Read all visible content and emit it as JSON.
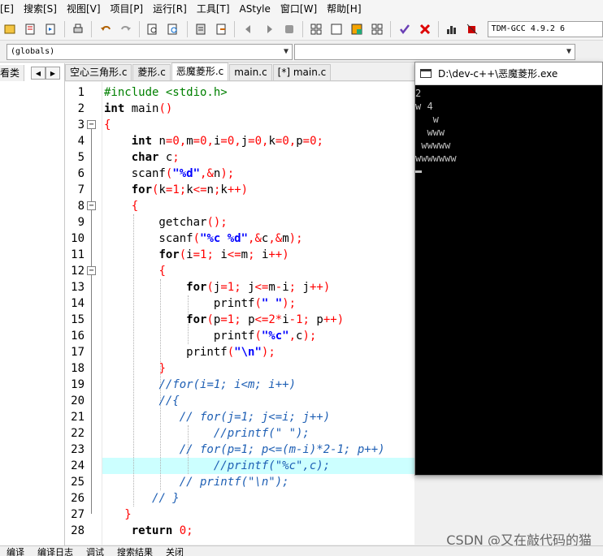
{
  "menu": [
    "[E]",
    "搜索[S]",
    "视图[V]",
    "项目[P]",
    "运行[R]",
    "工具[T]",
    "AStyle",
    "窗口[W]",
    "帮助[H]"
  ],
  "toolbar": {
    "compiler": "TDM-GCC 4.9.2 6",
    "icons": [
      "insert-icon",
      "toggle-bookmark-icon",
      "goto-bookmark-icon",
      "print-icon",
      "undo-icon",
      "redo-icon",
      "find-icon",
      "replace-icon",
      "new-class-icon",
      "toggle-icon",
      "back-icon",
      "forward-icon",
      "comment-icon",
      "compile-icon",
      "run-icon",
      "compile-run-icon",
      "rebuild-icon",
      "check-icon",
      "stop-icon",
      "chart-icon",
      "debug-icon"
    ]
  },
  "globals": {
    "value": "(globals)"
  },
  "left_panel": {
    "tab_label": "看类"
  },
  "tabs": [
    {
      "label": "空心三角形.c",
      "active": false
    },
    {
      "label": "菱形.c",
      "active": false
    },
    {
      "label": "恶魔菱形.c",
      "active": true
    },
    {
      "label": "main.c",
      "active": false
    },
    {
      "label": "[*] main.c",
      "active": false
    }
  ],
  "line_numbers": [
    "1",
    "2",
    "3",
    "4",
    "5",
    "6",
    "7",
    "8",
    "9",
    "10",
    "11",
    "12",
    "13",
    "14",
    "15",
    "16",
    "17",
    "18",
    "19",
    "20",
    "21",
    "22",
    "23",
    "24",
    "25",
    "26",
    "27",
    "28"
  ],
  "code": [
    [
      [
        "pp",
        "#include <stdio.h>"
      ]
    ],
    [
      [
        "kw",
        "int"
      ],
      [
        "plain",
        " main"
      ],
      [
        "bracket",
        "()"
      ]
    ],
    [
      [
        "bracket",
        "{"
      ]
    ],
    [
      [
        "plain",
        "    "
      ],
      [
        "kw",
        "int"
      ],
      [
        "plain",
        " n"
      ],
      [
        "op",
        "="
      ],
      [
        "num",
        "0"
      ],
      [
        "op",
        ","
      ],
      [
        "plain",
        "m"
      ],
      [
        "op",
        "="
      ],
      [
        "num",
        "0"
      ],
      [
        "op",
        ","
      ],
      [
        "plain",
        "i"
      ],
      [
        "op",
        "="
      ],
      [
        "num",
        "0"
      ],
      [
        "op",
        ","
      ],
      [
        "plain",
        "j"
      ],
      [
        "op",
        "="
      ],
      [
        "num",
        "0"
      ],
      [
        "op",
        ","
      ],
      [
        "plain",
        "k"
      ],
      [
        "op",
        "="
      ],
      [
        "num",
        "0"
      ],
      [
        "op",
        ","
      ],
      [
        "plain",
        "p"
      ],
      [
        "op",
        "="
      ],
      [
        "num",
        "0"
      ],
      [
        "op",
        ";"
      ]
    ],
    [
      [
        "plain",
        "    "
      ],
      [
        "kw",
        "char"
      ],
      [
        "plain",
        " c"
      ],
      [
        "op",
        ";"
      ]
    ],
    [
      [
        "plain",
        "    scanf"
      ],
      [
        "bracket",
        "("
      ],
      [
        "str",
        "\"%d\""
      ],
      [
        "op",
        ",&"
      ],
      [
        "plain",
        "n"
      ],
      [
        "bracket",
        ")"
      ],
      [
        "op",
        ";"
      ]
    ],
    [
      [
        "plain",
        "    "
      ],
      [
        "kw",
        "for"
      ],
      [
        "bracket",
        "("
      ],
      [
        "plain",
        "k"
      ],
      [
        "op",
        "="
      ],
      [
        "num",
        "1"
      ],
      [
        "op",
        ";"
      ],
      [
        "plain",
        "k"
      ],
      [
        "op",
        "<="
      ],
      [
        "plain",
        "n"
      ],
      [
        "op",
        ";"
      ],
      [
        "plain",
        "k"
      ],
      [
        "op",
        "++"
      ],
      [
        "bracket",
        ")"
      ]
    ],
    [
      [
        "plain",
        "    "
      ],
      [
        "bracket",
        "{"
      ]
    ],
    [
      [
        "plain",
        "        getchar"
      ],
      [
        "bracket",
        "()"
      ],
      [
        "op",
        ";"
      ]
    ],
    [
      [
        "plain",
        "        scanf"
      ],
      [
        "bracket",
        "("
      ],
      [
        "str",
        "\"%c %d\""
      ],
      [
        "op",
        ",&"
      ],
      [
        "plain",
        "c"
      ],
      [
        "op",
        ",&"
      ],
      [
        "plain",
        "m"
      ],
      [
        "bracket",
        ")"
      ],
      [
        "op",
        ";"
      ]
    ],
    [
      [
        "plain",
        "        "
      ],
      [
        "kw",
        "for"
      ],
      [
        "bracket",
        "("
      ],
      [
        "plain",
        "i"
      ],
      [
        "op",
        "="
      ],
      [
        "num",
        "1"
      ],
      [
        "op",
        ";"
      ],
      [
        "plain",
        " i"
      ],
      [
        "op",
        "<="
      ],
      [
        "plain",
        "m"
      ],
      [
        "op",
        ";"
      ],
      [
        "plain",
        " i"
      ],
      [
        "op",
        "++"
      ],
      [
        "bracket",
        ")"
      ]
    ],
    [
      [
        "plain",
        "        "
      ],
      [
        "bracket",
        "{"
      ]
    ],
    [
      [
        "plain",
        "            "
      ],
      [
        "kw",
        "for"
      ],
      [
        "bracket",
        "("
      ],
      [
        "plain",
        "j"
      ],
      [
        "op",
        "="
      ],
      [
        "num",
        "1"
      ],
      [
        "op",
        ";"
      ],
      [
        "plain",
        " j"
      ],
      [
        "op",
        "<="
      ],
      [
        "plain",
        "m"
      ],
      [
        "op",
        "-"
      ],
      [
        "plain",
        "i"
      ],
      [
        "op",
        ";"
      ],
      [
        "plain",
        " j"
      ],
      [
        "op",
        "++"
      ],
      [
        "bracket",
        ")"
      ]
    ],
    [
      [
        "plain",
        "                printf"
      ],
      [
        "bracket",
        "("
      ],
      [
        "str",
        "\" \""
      ],
      [
        "bracket",
        ")"
      ],
      [
        "op",
        ";"
      ]
    ],
    [
      [
        "plain",
        "            "
      ],
      [
        "kw",
        "for"
      ],
      [
        "bracket",
        "("
      ],
      [
        "plain",
        "p"
      ],
      [
        "op",
        "="
      ],
      [
        "num",
        "1"
      ],
      [
        "op",
        ";"
      ],
      [
        "plain",
        " p"
      ],
      [
        "op",
        "<="
      ],
      [
        "num",
        "2"
      ],
      [
        "op",
        "*"
      ],
      [
        "plain",
        "i"
      ],
      [
        "op",
        "-"
      ],
      [
        "num",
        "1"
      ],
      [
        "op",
        ";"
      ],
      [
        "plain",
        " p"
      ],
      [
        "op",
        "++"
      ],
      [
        "bracket",
        ")"
      ]
    ],
    [
      [
        "plain",
        "                printf"
      ],
      [
        "bracket",
        "("
      ],
      [
        "str",
        "\"%c\""
      ],
      [
        "op",
        ","
      ],
      [
        "plain",
        "c"
      ],
      [
        "bracket",
        ")"
      ],
      [
        "op",
        ";"
      ]
    ],
    [
      [
        "plain",
        "            printf"
      ],
      [
        "bracket",
        "("
      ],
      [
        "str",
        "\"\\n\""
      ],
      [
        "bracket",
        ")"
      ],
      [
        "op",
        ";"
      ]
    ],
    [
      [
        "plain",
        "        "
      ],
      [
        "bracket",
        "}"
      ]
    ],
    [
      [
        "plain",
        "        "
      ],
      [
        "cm",
        "//for(i=1; i<m; i++)"
      ]
    ],
    [
      [
        "plain",
        "        "
      ],
      [
        "cm",
        "//{"
      ]
    ],
    [
      [
        "plain",
        "           "
      ],
      [
        "cm",
        "// for(j=1; j<=i; j++)"
      ]
    ],
    [
      [
        "plain",
        "                "
      ],
      [
        "cm",
        "//printf(\" \");"
      ]
    ],
    [
      [
        "plain",
        "           "
      ],
      [
        "cm",
        "// for(p=1; p<=(m-i)*2-1; p++)"
      ]
    ],
    [
      [
        "plain",
        "                "
      ],
      [
        "cm",
        "//printf(\"%c\",c);"
      ]
    ],
    [
      [
        "plain",
        "           "
      ],
      [
        "cm",
        "// printf(\"\\n\");"
      ]
    ],
    [
      [
        "plain",
        "       "
      ],
      [
        "cm",
        "// }"
      ]
    ],
    [
      [
        "plain",
        "   "
      ],
      [
        "bracket",
        "}"
      ]
    ],
    [
      [
        "plain",
        "    "
      ],
      [
        "kw",
        "return"
      ],
      [
        "plain",
        " "
      ],
      [
        "num",
        "0"
      ],
      [
        "op",
        ";"
      ]
    ]
  ],
  "highlight_line": 24,
  "fold_markers": [
    {
      "line": 3,
      "symbol": "−"
    },
    {
      "line": 8,
      "symbol": "−"
    },
    {
      "line": 12,
      "symbol": "−"
    }
  ],
  "console": {
    "title": "D:\\dev-c++\\恶魔菱形.exe",
    "lines": [
      "2",
      "w 4",
      "   w",
      "  www",
      " wwwww",
      "wwwwwww"
    ]
  },
  "watermark": "CSDN @又在敲代码的猫",
  "bottom_tabs": [
    "编译",
    "编译日志",
    "调试",
    "搜索结果",
    "关闭"
  ]
}
